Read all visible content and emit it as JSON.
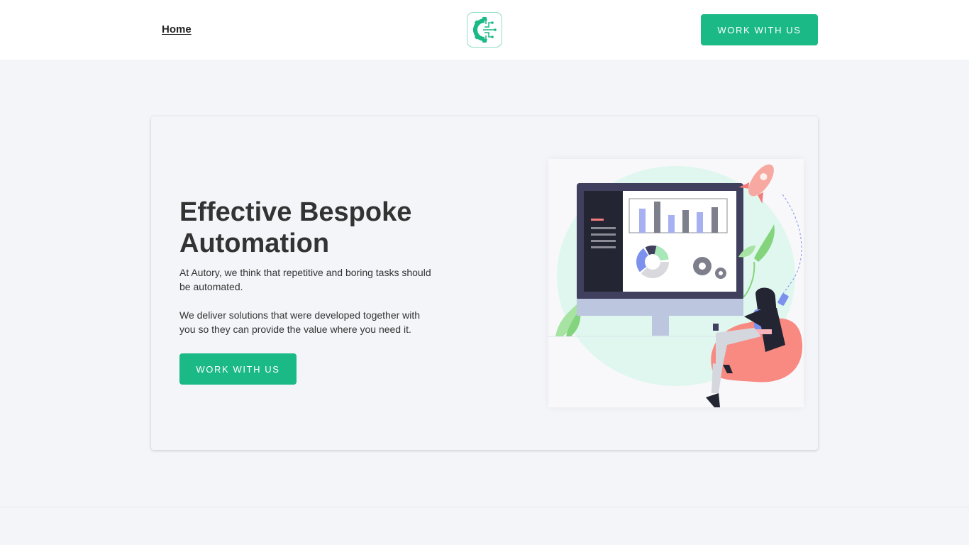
{
  "header": {
    "nav_home": "Home",
    "logo_icon": "gear-circuit-logo-icon",
    "cta_label": "Work with us"
  },
  "hero": {
    "title": "Effective Bespoke Automation",
    "paragraph_1": "At Autory, we think that repetitive and boring tasks should be automated.",
    "paragraph_2": "We deliver solutions that were developed together with you so they can provide the value where you need it.",
    "cta_label": "Work with us",
    "illustration": "person-with-dashboard-monitor-illustration"
  },
  "colors": {
    "accent": "#1bb986",
    "background": "#f4f5f9",
    "header_bg": "#ffffff",
    "text": "#333333"
  }
}
